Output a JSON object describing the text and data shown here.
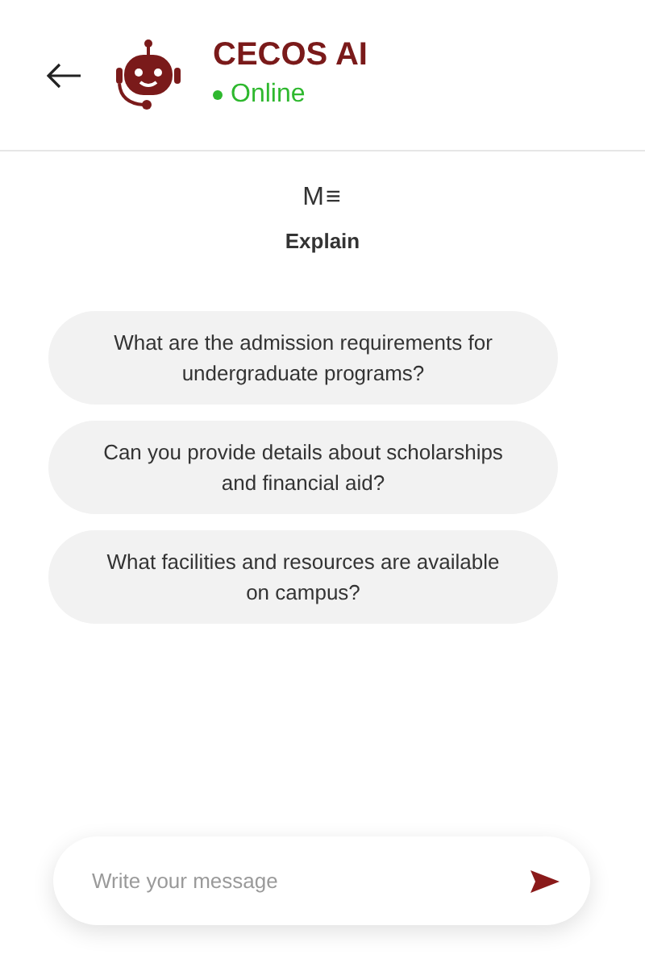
{
  "header": {
    "title": "CECOS AI",
    "status": "Online",
    "online": true
  },
  "mode": {
    "icon_text": "M≡",
    "label": "Explain"
  },
  "suggestions": [
    {
      "text": "What are the admission requirements for undergraduate programs?"
    },
    {
      "text": "Can you provide details about scholarships and financial aid?"
    },
    {
      "text": "What facilities and resources are available on campus?"
    }
  ],
  "composer": {
    "placeholder": "Write your message"
  }
}
